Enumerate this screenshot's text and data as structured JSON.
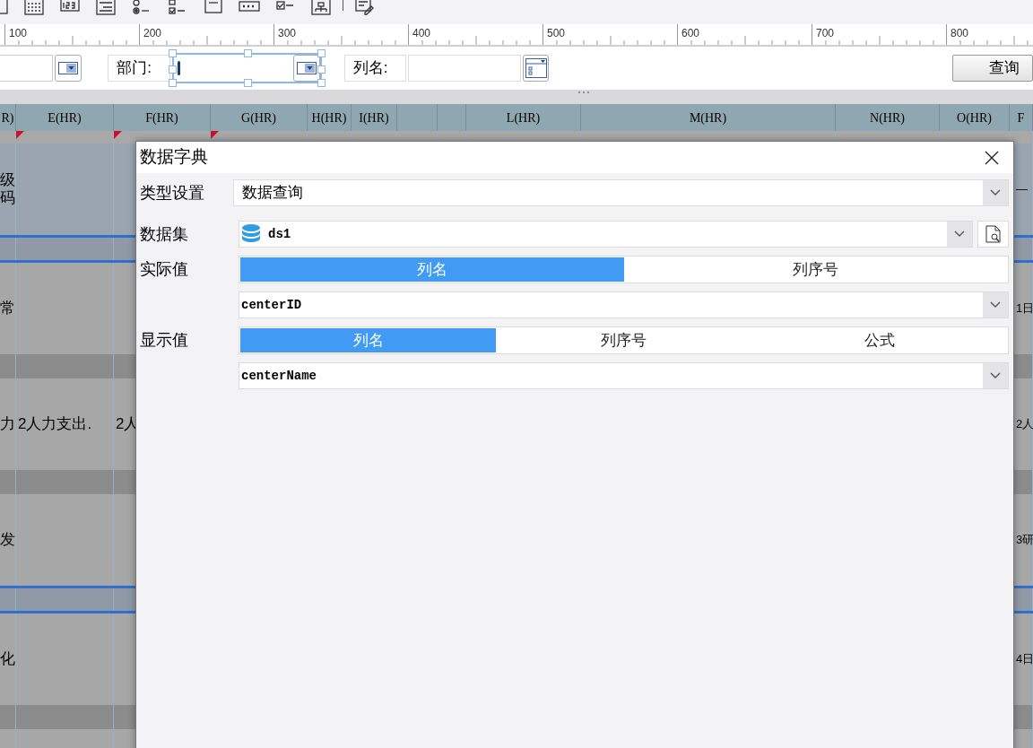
{
  "ruler": {
    "labels": [
      "100",
      "200",
      "300",
      "400",
      "500",
      "600",
      "700",
      "800"
    ]
  },
  "filter_bar": {
    "department_label": "部门:",
    "column_label": "列名:",
    "query_button": "查询"
  },
  "sheet": {
    "columns": [
      "R)",
      "E(HR)",
      "F(HR)",
      "G(HR)",
      "H(HR)",
      "I(HR)",
      "",
      "",
      "L(HR)",
      "M(HR)",
      "N(HR)",
      "O(HR)",
      "F"
    ],
    "rows": [
      {
        "kind": "marker"
      },
      {
        "kind": "selected-data",
        "cells": [
          [
            "级",
            "码"
          ]
        ],
        "last_cell": [
          "—"
        ]
      },
      {
        "kind": "selected-band"
      },
      {
        "kind": "data",
        "cells": [
          [
            "常"
          ]
        ],
        "last_cell": [
          "1日"
        ]
      },
      {
        "kind": "band"
      },
      {
        "kind": "data",
        "cells": [
          [
            "力"
          ],
          [
            "2人力支出."
          ],
          [
            "2人"
          ]
        ],
        "last_cell": [
          "2人"
        ]
      },
      {
        "kind": "band"
      },
      {
        "kind": "data",
        "cells": [
          [
            "发"
          ]
        ],
        "last_cell": [
          "3研"
        ]
      },
      {
        "kind": "selected-band"
      },
      {
        "kind": "data",
        "cells": [
          [
            "化"
          ]
        ],
        "last_cell": [
          "4日"
        ]
      },
      {
        "kind": "band"
      },
      {
        "kind": "data"
      }
    ]
  },
  "dialog": {
    "title": "数据字典",
    "fields": [
      {
        "kind": "select",
        "label": "类型设置",
        "value": "数据查询"
      },
      {
        "kind": "dataset",
        "label": "数据集",
        "value": "ds1"
      },
      {
        "kind": "segmented",
        "label": "实际值",
        "options": [
          {
            "label": "列名",
            "selected": true
          },
          {
            "label": "列序号",
            "selected": false
          }
        ]
      },
      {
        "kind": "column-select",
        "value": "centerID"
      },
      {
        "kind": "segmented",
        "label": "显示值",
        "options": [
          {
            "label": "列名",
            "selected": true
          },
          {
            "label": "列序号",
            "selected": false
          },
          {
            "label": "公式",
            "selected": false
          }
        ]
      },
      {
        "kind": "column-select",
        "value": "centerName"
      }
    ]
  }
}
